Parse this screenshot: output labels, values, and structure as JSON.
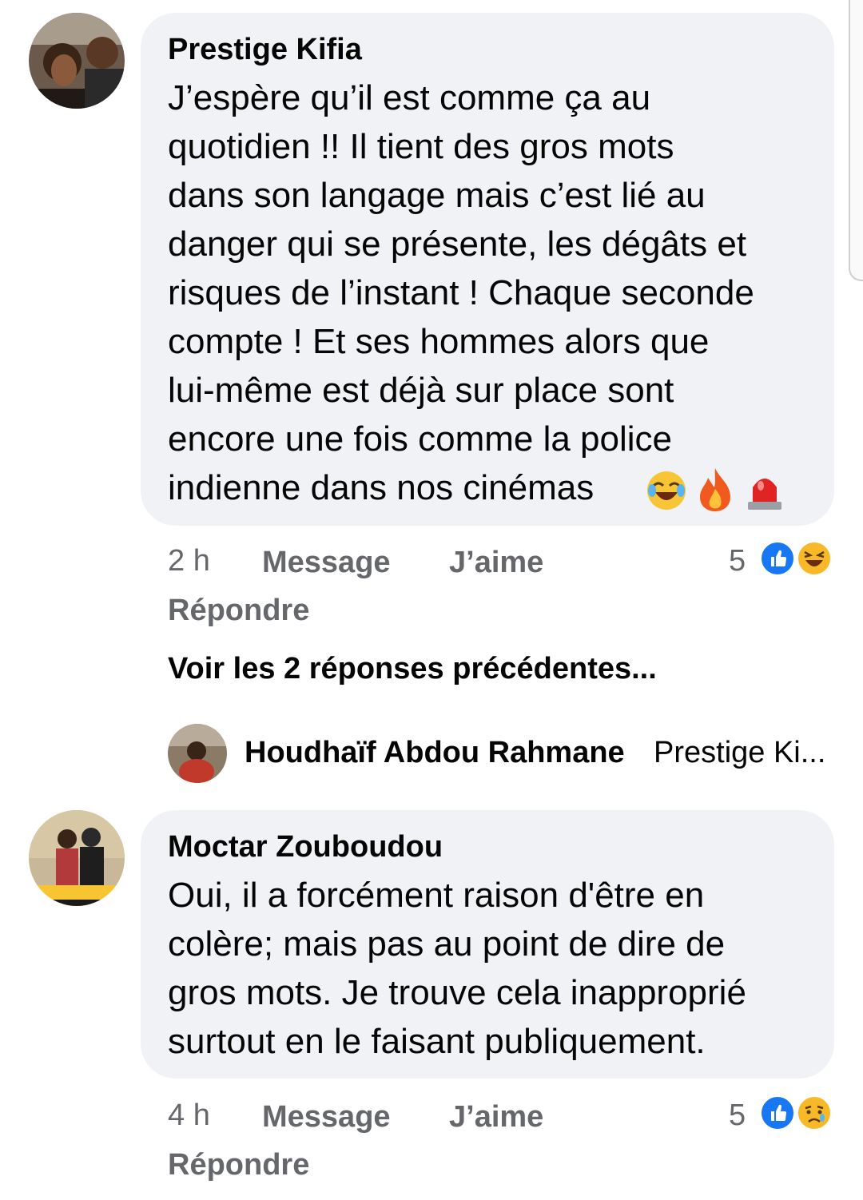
{
  "comments": [
    {
      "author": "Prestige Kifia",
      "lines": [
        "J’espère qu’il est comme ça au",
        "quotidien !! Il tient des gros mots",
        "dans son langage mais c’est lié au",
        "danger qui se présente, les dégâts et",
        "risques de l’instant ! Chaque seconde",
        "compte ! Et ses hommes alors que",
        "lui-même est déjà sur place sont",
        "encore une fois comme la police",
        "indienne dans nos cinémas"
      ],
      "emojis": [
        "😂",
        "🔥",
        "🚨"
      ],
      "time": "2 h",
      "message_label": "Message",
      "like_label": "J’aime",
      "reply_label": "Répondre",
      "reaction_count": "5",
      "reaction_icons": [
        "like-icon",
        "haha-icon"
      ]
    },
    {
      "author": "Moctar Zouboudou",
      "lines": [
        "Oui, il a forcément raison d'être en",
        "colère; mais pas au point de dire de",
        "gros mots. Je trouve cela inapproprié",
        "surtout en le faisant publiquement."
      ],
      "time": "4 h",
      "message_label": "Message",
      "like_label": "J’aime",
      "reply_label": "Répondre",
      "reaction_count": "5",
      "reaction_icons": [
        "like-icon",
        "sad-icon"
      ]
    }
  ],
  "replies_thread": {
    "see_previous": "Voir les 2 réponses précédentes...",
    "reply_author": "Houdhaïf Abdou Rahmane",
    "reply_preview": "Prestige Ki..."
  },
  "colors": {
    "bubble": "#f0f2f5",
    "meta_text": "#65676b",
    "like_blue": "#1877f2",
    "emoji_yellow": "#f7b928"
  }
}
